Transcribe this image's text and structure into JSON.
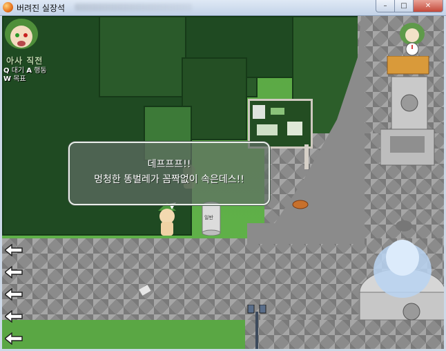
{
  "window": {
    "title": "버려진 실장석",
    "buttons": {
      "minimize": "–",
      "maximize": "□",
      "close": "✕"
    }
  },
  "hud": {
    "status": "아사 직전",
    "controls": [
      {
        "key": "Q",
        "label": "대기"
      },
      {
        "key": "A",
        "label": "행동"
      },
      {
        "key": "W",
        "label": "목표"
      }
    ]
  },
  "dialog": {
    "line1": "데프프프!!",
    "line2": "멍청한 똥벌레가 꼼짝없이 속은데스!!"
  },
  "trash_can_label": "일반",
  "nav_arrows": [
    "left-arrow",
    "left-arrow",
    "left-arrow",
    "left-arrow",
    "left-arrow"
  ],
  "colors": {
    "grass": "#5fb04a",
    "forest": "#1f4a22",
    "pavement": "#8b8b8b",
    "dialog_border": "#e9eee9",
    "status_text": "#b8d6a8"
  }
}
